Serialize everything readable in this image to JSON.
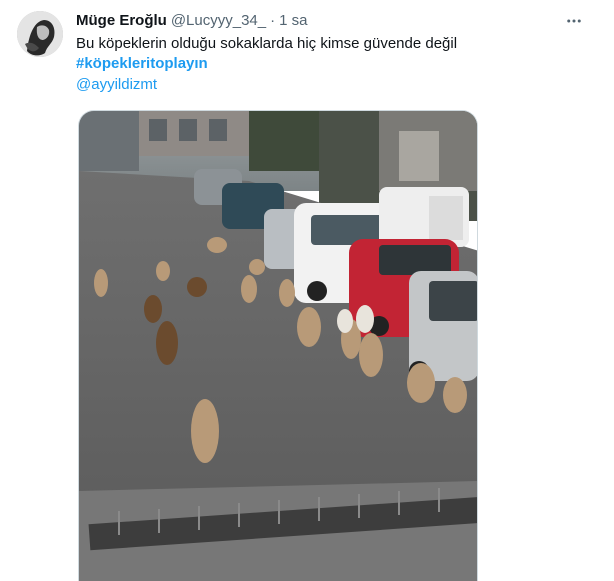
{
  "tweet": {
    "display_name": "Müge Eroğlu",
    "handle": "@Lucyyy_34_",
    "separator": "·",
    "time": "1 sa",
    "text": "Bu köpeklerin olduğu sokaklarda hiç kimse güvende değil",
    "hashtag": "#köpekleritoplayın",
    "mention": "@ayyildizmt"
  },
  "icons": {
    "more": "more-horizontal-icon",
    "avatar": "avatar-image"
  },
  "colors": {
    "link": "#1d9bf0",
    "text": "#0f1419",
    "secondary": "#536471",
    "media_border": "#cfd9de"
  }
}
